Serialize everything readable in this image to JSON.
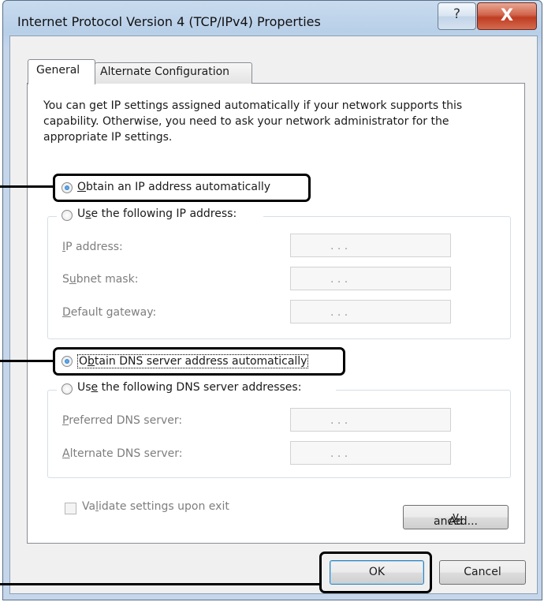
{
  "window": {
    "title": "Internet Protocol Version 4 (TCP/IPv4) Properties",
    "help_label": "?",
    "close_label": "X"
  },
  "tabs": [
    {
      "label": "General",
      "active": true
    },
    {
      "label": "Alternate Configuration",
      "active": false
    }
  ],
  "intro": "You can get IP settings assigned automatically if your network supports this capability. Otherwise, you need to ask your network administrator for the appropriate IP settings.",
  "ip": {
    "auto": {
      "pre": "",
      "key": "O",
      "post": "btain an IP address automatically",
      "selected": true
    },
    "manual": {
      "pre": "U",
      "key": "s",
      "post": "e the following IP address:",
      "selected": false
    },
    "fields": [
      {
        "pre": "",
        "key": "I",
        "post": "P address:",
        "value": ".  .  ."
      },
      {
        "pre": "S",
        "key": "u",
        "post": "bnet mask:",
        "value": ".  .  ."
      },
      {
        "pre": "",
        "key": "D",
        "post": "efault gateway:",
        "value": ".  .  ."
      }
    ]
  },
  "dns": {
    "auto": {
      "pre": "O",
      "key": "b",
      "post": "tain DNS server address automatically",
      "selected": true
    },
    "manual": {
      "pre": "Us",
      "key": "e",
      "post": " the following DNS server addresses:",
      "selected": false
    },
    "fields": [
      {
        "pre": "",
        "key": "P",
        "post": "referred DNS server:",
        "value": ".  .  ."
      },
      {
        "pre": "",
        "key": "A",
        "post": "lternate DNS server:",
        "value": ".  .  ."
      }
    ]
  },
  "validate": {
    "pre": "Va",
    "key": "l",
    "post": "idate settings upon exit",
    "checked": false
  },
  "buttons": {
    "advanced": {
      "pre": "Ad",
      "key": "v",
      "post": "anced..."
    },
    "ok": "OK",
    "cancel": "Cancel"
  }
}
